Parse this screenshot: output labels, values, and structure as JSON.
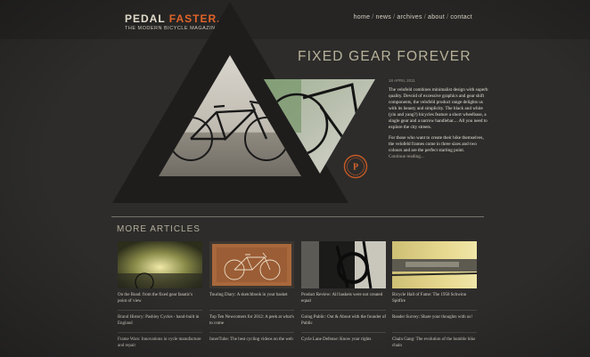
{
  "site": {
    "logo_main": "PEDAL",
    "logo_accent": "FASTER.",
    "tagline": "THE MODERN BICYCLE MAGAZINE"
  },
  "nav": {
    "items": [
      "home",
      "news",
      "archives",
      "about",
      "contact"
    ]
  },
  "hero": {
    "title": "FIXED GEAR FOREVER",
    "date": "18 APRIL 2011",
    "paragraph_1": "The velofeld combines minimalist design with superb quality. Devoid of excessive graphics and gear shift components, the velofeld product range delights us with its beauty and simplicity. The black and white (yin and yang?) bicycles feature a short wheelbase, a single gear and a narrow handlebar.... All you need to explore the city streets.",
    "paragraph_2": "For those who want to create their bike themselves, the velofeld frames come in three sizes and two colours and are the perfect starting point.",
    "continue": "Continue reading..."
  },
  "more_articles": {
    "heading": "MORE ARTICLES",
    "columns": [
      {
        "articles": [
          "On the Road: from the fixed gear fanatic's point of view",
          "Brand History: Pashley Cycles - hand-built in England",
          "Frame Wars: Innovations in cycle manufacture and repair"
        ]
      },
      {
        "articles": [
          "Touring Diary: A sketchbook in your basket",
          "Top Ten Newcomers for 2012: A peek at what's to come",
          "InnerTube: The best cycling videos on the web"
        ]
      },
      {
        "articles": [
          "Product Review: All baskets were not created equal",
          "Going Public: Out & About with the founder of Public",
          "Cycle Lane Defense: Know your rights"
        ]
      },
      {
        "articles": [
          "Bicycle Hall of Fame: The 1958 Schwinn Spitfire",
          "Reader Survey: Share your thoughts with us!",
          "Chain Gang: The evolution of the humble bike chain"
        ]
      }
    ]
  },
  "colors": {
    "background": "#2d2c2b",
    "accent": "#e0642a",
    "heading": "#b9b39a"
  }
}
